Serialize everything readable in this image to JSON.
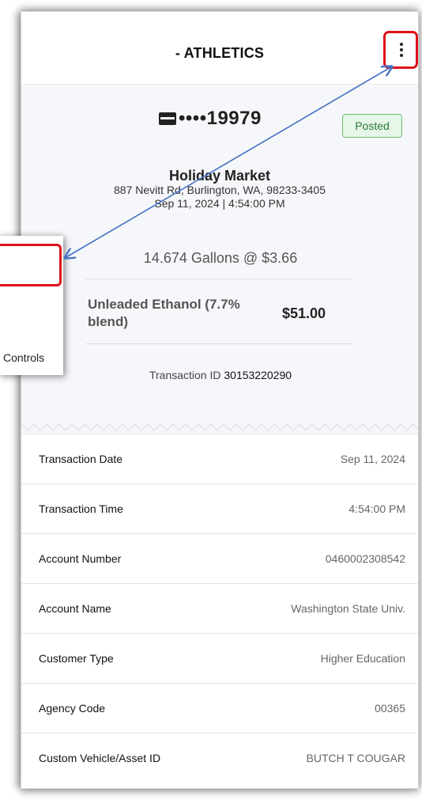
{
  "header": {
    "title": "- ATHLETICS"
  },
  "transaction": {
    "card_number": "••••19979",
    "status": "Posted",
    "merchant_name": "Holiday Market",
    "merchant_address": "887 Nevitt Rd, Burlington, WA, 98233-3405",
    "datetime": "Sep 11, 2024 | 4:54:00 PM",
    "gallons_line": "14.674 Gallons @ $3.66",
    "product": "Unleaded Ethanol (7.7% blend)",
    "amount": "$51.00",
    "transaction_id_label": "Transaction ID",
    "transaction_id": "30153220290"
  },
  "details": [
    {
      "label": "Transaction Date",
      "value": "Sep 11, 2024"
    },
    {
      "label": "Transaction Time",
      "value": "4:54:00 PM"
    },
    {
      "label": "Account Number",
      "value": "0460002308542"
    },
    {
      "label": "Account Name",
      "value": "Washington State Univ."
    },
    {
      "label": "Customer Type",
      "value": "Higher Education"
    },
    {
      "label": "Agency Code",
      "value": "00365"
    },
    {
      "label": "Custom Vehicle/Asset ID",
      "value": "BUTCH T COUGAR"
    }
  ],
  "popup_menu": {
    "controls_label": "Controls"
  },
  "colors": {
    "highlight": "#e0101a",
    "arrow": "#4472c4",
    "posted_badge": "#e6f6e8"
  },
  "icons": {
    "menu": "kebab-menu-icon",
    "card": "credit-card-icon"
  }
}
